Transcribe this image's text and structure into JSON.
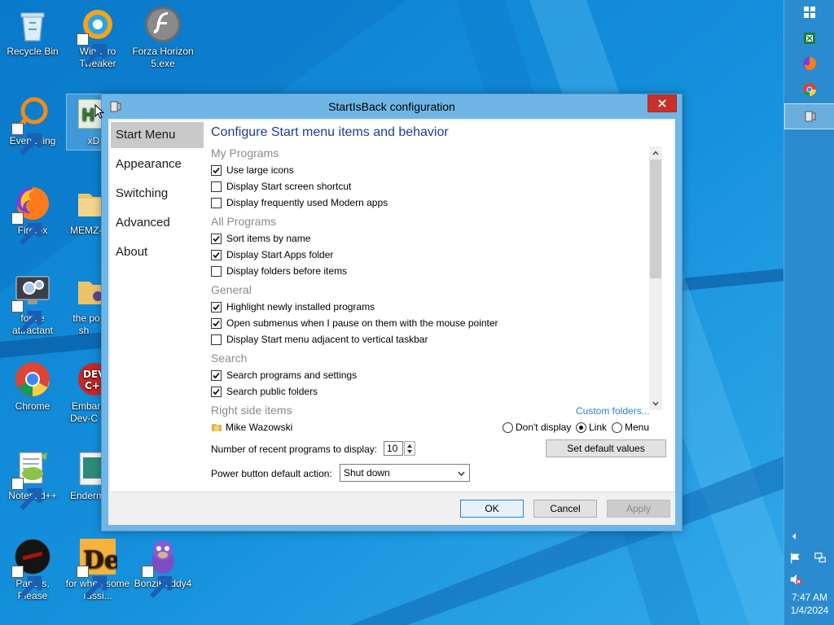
{
  "desktop": {
    "icons": [
      {
        "id": "recycle-bin",
        "label": "Recycle Bin"
      },
      {
        "id": "winaero-tweaker",
        "label": "Winaero Tweaker"
      },
      {
        "id": "forza-horizon",
        "label": "Forza Horizon 5.exe"
      },
      {
        "id": "everything",
        "label": "Everything"
      },
      {
        "id": "xd",
        "label": "xD"
      },
      {
        "id": "firefox",
        "label": "Firefox"
      },
      {
        "id": "memz",
        "label": "MEMZ-"
      },
      {
        "id": "forkie",
        "label": "forkie attractant"
      },
      {
        "id": "the-po",
        "label": "the po sh"
      },
      {
        "id": "chrome",
        "label": "Chrome"
      },
      {
        "id": "embarcadero",
        "label": "Embarc Dev-C"
      },
      {
        "id": "notepadpp",
        "label": "Notepad++"
      },
      {
        "id": "enderm",
        "label": "Enderm"
      },
      {
        "id": "papers-please",
        "label": "Papers, Please"
      },
      {
        "id": "for-when",
        "label": "for when some russi..."
      },
      {
        "id": "bonzibuddy",
        "label": "BonziBuddy4"
      }
    ]
  },
  "taskbar": {
    "time": "7:47 AM",
    "date": "1/4/2024"
  },
  "dialog": {
    "title": "StartIsBack configuration",
    "nav": [
      "Start Menu",
      "Appearance",
      "Switching",
      "Advanced",
      "About"
    ],
    "heading": "Configure Start menu items and behavior",
    "groups": {
      "my_programs": {
        "title": "My Programs",
        "options": [
          {
            "label": "Use large icons",
            "checked": true
          },
          {
            "label": "Display Start screen shortcut",
            "checked": false
          },
          {
            "label": "Display frequently used Modern apps",
            "checked": false
          }
        ]
      },
      "all_programs": {
        "title": "All Programs",
        "options": [
          {
            "label": "Sort items by name",
            "checked": true
          },
          {
            "label": "Display Start Apps folder",
            "checked": true
          },
          {
            "label": "Display folders before items",
            "checked": false
          }
        ]
      },
      "general": {
        "title": "General",
        "options": [
          {
            "label": "Highlight newly installed programs",
            "checked": true
          },
          {
            "label": "Open submenus when I pause on them with the mouse pointer",
            "checked": true
          },
          {
            "label": "Display Start menu adjacent to vertical taskbar",
            "checked": false
          }
        ]
      },
      "search": {
        "title": "Search",
        "options": [
          {
            "label": "Search programs and settings",
            "checked": true
          },
          {
            "label": "Search public folders",
            "checked": true
          }
        ]
      },
      "right_side": {
        "title": "Right side items",
        "custom_link": "Custom folders...",
        "item": "Mike Wazowski",
        "radios": [
          "Don't display",
          "Link",
          "Menu"
        ],
        "selected": "Link"
      }
    },
    "recent_label": "Number of recent programs to display:",
    "recent_value": "10",
    "set_default": "Set default values",
    "power_label": "Power button default action:",
    "power_value": "Shut down",
    "buttons": {
      "ok": "OK",
      "cancel": "Cancel",
      "apply": "Apply"
    }
  },
  "colors": {
    "wallpaper": "#1a8fd6",
    "taskbar": "#2a8ccf",
    "dialog_frame": "#6fb6e6",
    "heading": "#1e3d8f",
    "link": "#2f7fd1",
    "close": "#c7312a"
  }
}
